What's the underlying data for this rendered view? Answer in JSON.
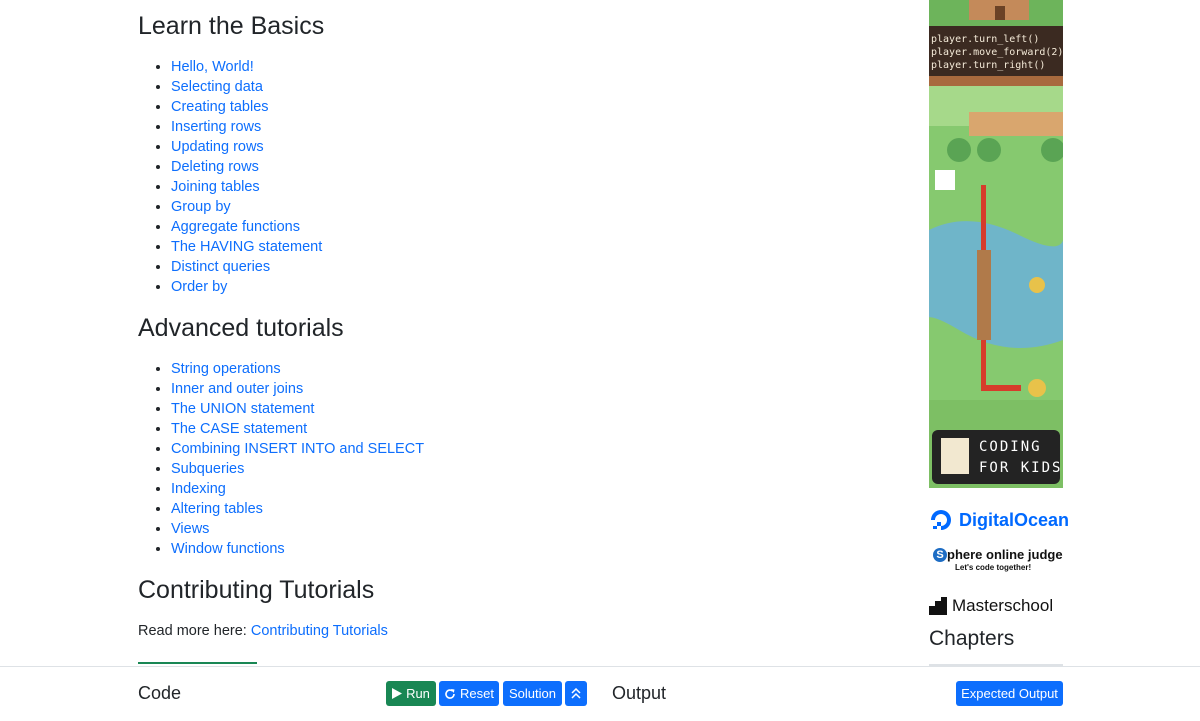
{
  "basics": {
    "title": "Learn the Basics",
    "items": [
      "Hello, World!",
      "Selecting data",
      "Creating tables",
      "Inserting rows",
      "Updating rows",
      "Deleting rows",
      "Joining tables",
      "Group by",
      "Aggregate functions",
      "The HAVING statement",
      "Distinct queries",
      "Order by"
    ]
  },
  "advanced": {
    "title": "Advanced tutorials",
    "items": [
      "String operations",
      "Inner and outer joins",
      "The UNION statement",
      "The CASE statement",
      "Combining INSERT INTO and SELECT",
      "Subqueries",
      "Indexing",
      "Altering tables",
      "Views",
      "Window functions"
    ]
  },
  "contributing": {
    "title": "Contributing Tutorials",
    "read_more": "Read more here:",
    "link": "Contributing Tutorials"
  },
  "sidebar": {
    "ad": {
      "code_lines": [
        "player.turn_left()",
        "player.move_forward(2)",
        "player.turn_right()"
      ],
      "badge_line1": "CODING",
      "badge_line2": "FOR KIDS"
    },
    "sponsors": {
      "digitalocean": "DigitalOcean",
      "sphere_title": "phere online judge",
      "sphere_s": "S",
      "sphere_tagline": "Let's code together!",
      "masterschool": "Masterschool"
    },
    "chapters_title": "Chapters"
  },
  "bottom_bar": {
    "code_label": "Code",
    "run": "Run",
    "reset": "Reset",
    "solution": "Solution",
    "output_label": "Output",
    "expected_output": "Expected Output"
  }
}
